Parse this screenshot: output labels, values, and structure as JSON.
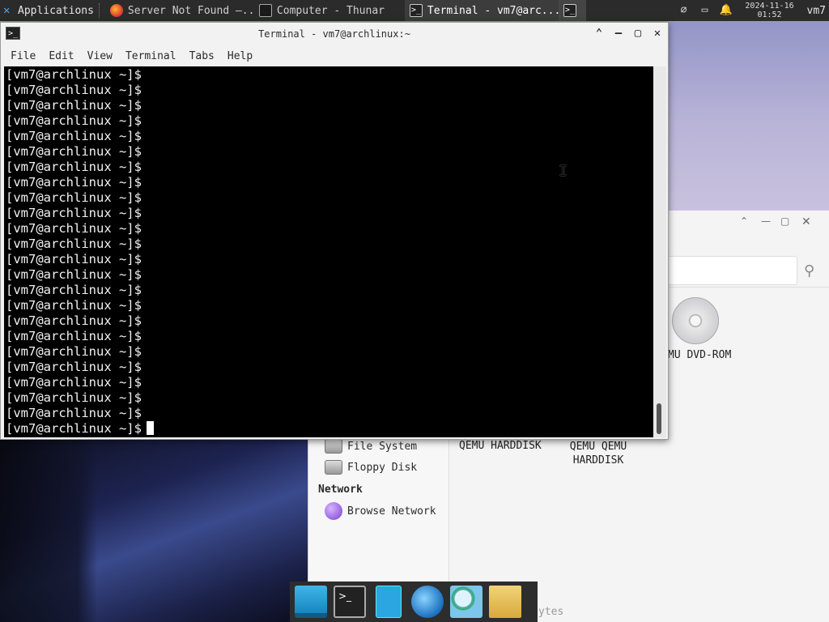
{
  "panel": {
    "applications_label": "Applications",
    "tasks": [
      {
        "label": "Server Not Found —...",
        "icon": "firefox-icon"
      },
      {
        "label": "Computer - Thunar",
        "icon": "monitor-icon"
      },
      {
        "label": "Terminal - vm7@arc...",
        "icon": "terminal-icon"
      }
    ],
    "clock_date": "2024-11-16",
    "clock_time": "01:52",
    "user": "vm7"
  },
  "terminal": {
    "title": "Terminal - vm7@archlinux:~",
    "menu": [
      "File",
      "Edit",
      "View",
      "Terminal",
      "Tabs",
      "Help"
    ],
    "prompt": "[vm7@archlinux ~]$",
    "prompt_count": 24
  },
  "thunar": {
    "sidebar": {
      "items_devices": [
        "File System",
        "Floppy Disk"
      ],
      "network_heading": "Network",
      "items_network": [
        "Browse Network"
      ]
    },
    "items": [
      {
        "label": "MU DVD-ROM"
      },
      {
        "label": "QEMU HARDDISK"
      },
      {
        "label": "QEMU QEMU HARDDISK"
      }
    ],
    "status_partial": "ytes"
  }
}
